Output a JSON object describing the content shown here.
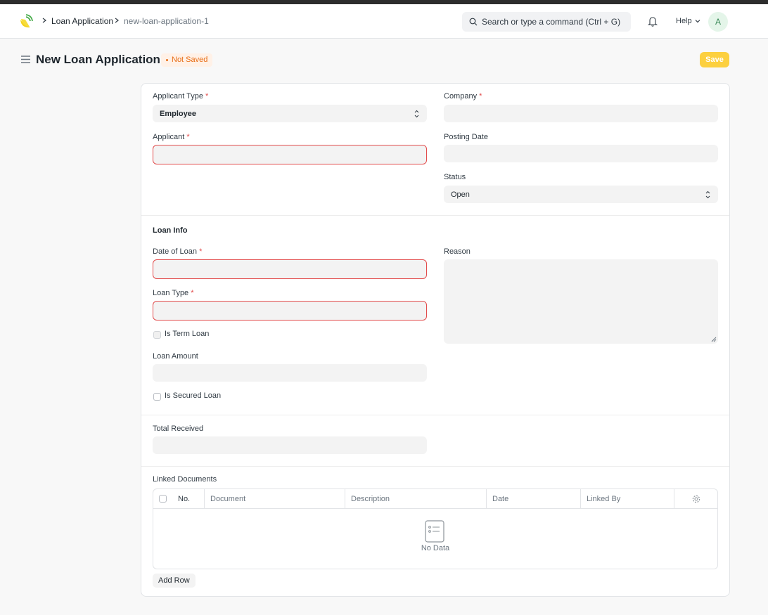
{
  "breadcrumbs": [
    "Loan Application",
    "new-loan-application-1"
  ],
  "search": {
    "placeholder": "Search or type a command (Ctrl + G)"
  },
  "navbar": {
    "help_label": "Help",
    "avatar_initial": "A"
  },
  "page": {
    "title": "New Loan Application",
    "status": "Not Saved",
    "save_label": "Save"
  },
  "form": {
    "applicant_type": {
      "label": "Applicant Type",
      "value": "Employee"
    },
    "company": {
      "label": "Company"
    },
    "applicant": {
      "label": "Applicant"
    },
    "posting_date": {
      "label": "Posting Date"
    },
    "status": {
      "label": "Status",
      "value": "Open"
    },
    "loan_info": {
      "title": "Loan Info",
      "date_of_loan": {
        "label": "Date of Loan"
      },
      "reason": {
        "label": "Reason"
      },
      "loan_type": {
        "label": "Loan Type"
      },
      "is_term_loan": {
        "label": "Is Term Loan"
      },
      "loan_amount": {
        "label": "Loan Amount"
      },
      "is_secured_loan": {
        "label": "Is Secured Loan"
      }
    },
    "total_received": {
      "label": "Total Received"
    },
    "linked_documents": {
      "label": "Linked Documents",
      "columns": [
        "No.",
        "Document",
        "Description",
        "Date",
        "Linked By"
      ],
      "empty_text": "No Data",
      "add_row_label": "Add Row"
    }
  },
  "colors": {
    "primary_button": "#fcd03f",
    "error_border": "#e24c4c",
    "indicator": "#e86c13"
  }
}
